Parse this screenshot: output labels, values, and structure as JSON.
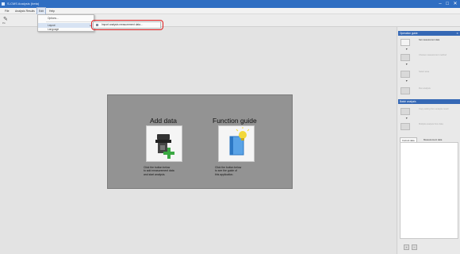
{
  "window": {
    "title": "S-CMS Analysis (beta)",
    "controls": [
      "–",
      "□",
      "✕"
    ]
  },
  "menu": {
    "items": [
      "File",
      "Analysis Results",
      "Edit",
      "Help"
    ]
  },
  "toolbar": {
    "button_icon": "pin-icon",
    "button_label": "Pin"
  },
  "dropdown": {
    "items": [
      "Options...",
      "Layout",
      "Language"
    ],
    "submenu_arrow": "▸"
  },
  "submenu": {
    "item_label": "Import analysis measurement data...",
    "item_icon": "import-icon"
  },
  "welcome": {
    "add_data": {
      "title": "Add data",
      "icon": "add-data-icon",
      "description": [
        "Click the button below",
        "to add measurement data",
        "and start analysis."
      ]
    },
    "function_guide": {
      "title": "Function guide",
      "icon": "function-guide-icon",
      "description": [
        "Click the button below",
        "to see the guide of",
        "this application."
      ]
    }
  },
  "right_panel": {
    "operation_guide": {
      "title": "Operation guide",
      "close": "✕",
      "steps": [
        {
          "label": "Set measurement data",
          "active": true
        },
        {
          "label": "Choose measurement method",
          "active": false
        },
        {
          "label": "Select area",
          "active": false
        },
        {
          "label": "Run analysis",
          "active": false
        }
      ]
    },
    "batch_analysis": {
      "title": "Batch analysis",
      "steps": [
        {
          "label": "Copy setting from analysis result",
          "active": false
        },
        {
          "label": "Multiple analysis from data",
          "active": false
        }
      ]
    },
    "tabs": [
      "Current data",
      "Measurement data"
    ],
    "footer_buttons": [
      "+",
      "−"
    ]
  },
  "colors": {
    "titlebar": "#2f6ec2",
    "panel_header": "#3568b5",
    "highlight_border": "#e02020",
    "welcome_panel": "#939393"
  }
}
